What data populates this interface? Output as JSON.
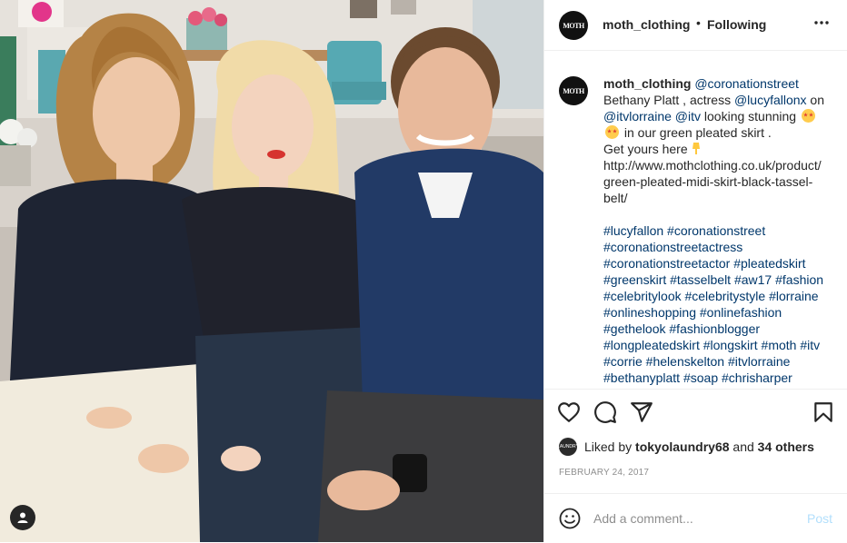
{
  "post": {
    "username": "moth_clothing",
    "follow_dot": "•",
    "follow_status": "Following",
    "avatar_text": "MOTH"
  },
  "caption": {
    "username": "moth_clothing",
    "lines": [
      [
        "Bethany Platt , actress ",
        "@lucyfallonx",
        " on"
      ],
      [
        "@itvlorraine",
        " ",
        "@itv",
        " looking stunning "
      ],
      [
        " in our green pleated skirt ."
      ],
      [
        "Get yours here"
      ],
      [
        "http://www.mothclothing.co.uk/product/"
      ],
      [
        "green-pleated-midi-skirt-black-tassel-"
      ],
      [
        "belt/"
      ]
    ],
    "first_mention": "@coronationstreet",
    "hashtags": [
      "#lucyfallon #coronationstreet",
      "#coronationstreetactress",
      "#coronationstreetactor #pleatedskirt",
      "#greenskirt #tasselbelt #aw17 #fashion",
      "#celebritylook #celebritystyle #lorraine",
      "#onlineshopping #onlinefashion",
      "#gethelook #fashionblogger",
      "#longpleatedskirt #longskirt #moth #itv",
      "#corrie #helenskelton #itvlorraine",
      "#bethanyplatt #soap #chrisharper"
    ]
  },
  "likes": {
    "prefix": "Liked by ",
    "user": "tokyolaundry68",
    "middle": " and ",
    "others": "34 others",
    "avatar_text": "LAUNDRY"
  },
  "date": "FEBRUARY 24, 2017",
  "comment": {
    "placeholder": "Add a comment...",
    "post_label": "Post",
    "post_color": "#b2dffc"
  },
  "icons": [
    "heart-icon",
    "comment-icon",
    "share-icon",
    "bookmark-icon",
    "more-icon",
    "emoji-icon",
    "user-tag-icon"
  ],
  "colors": {
    "text": "#262626",
    "link": "#00376b",
    "muted": "#8e8e8e",
    "border": "#efefef"
  }
}
